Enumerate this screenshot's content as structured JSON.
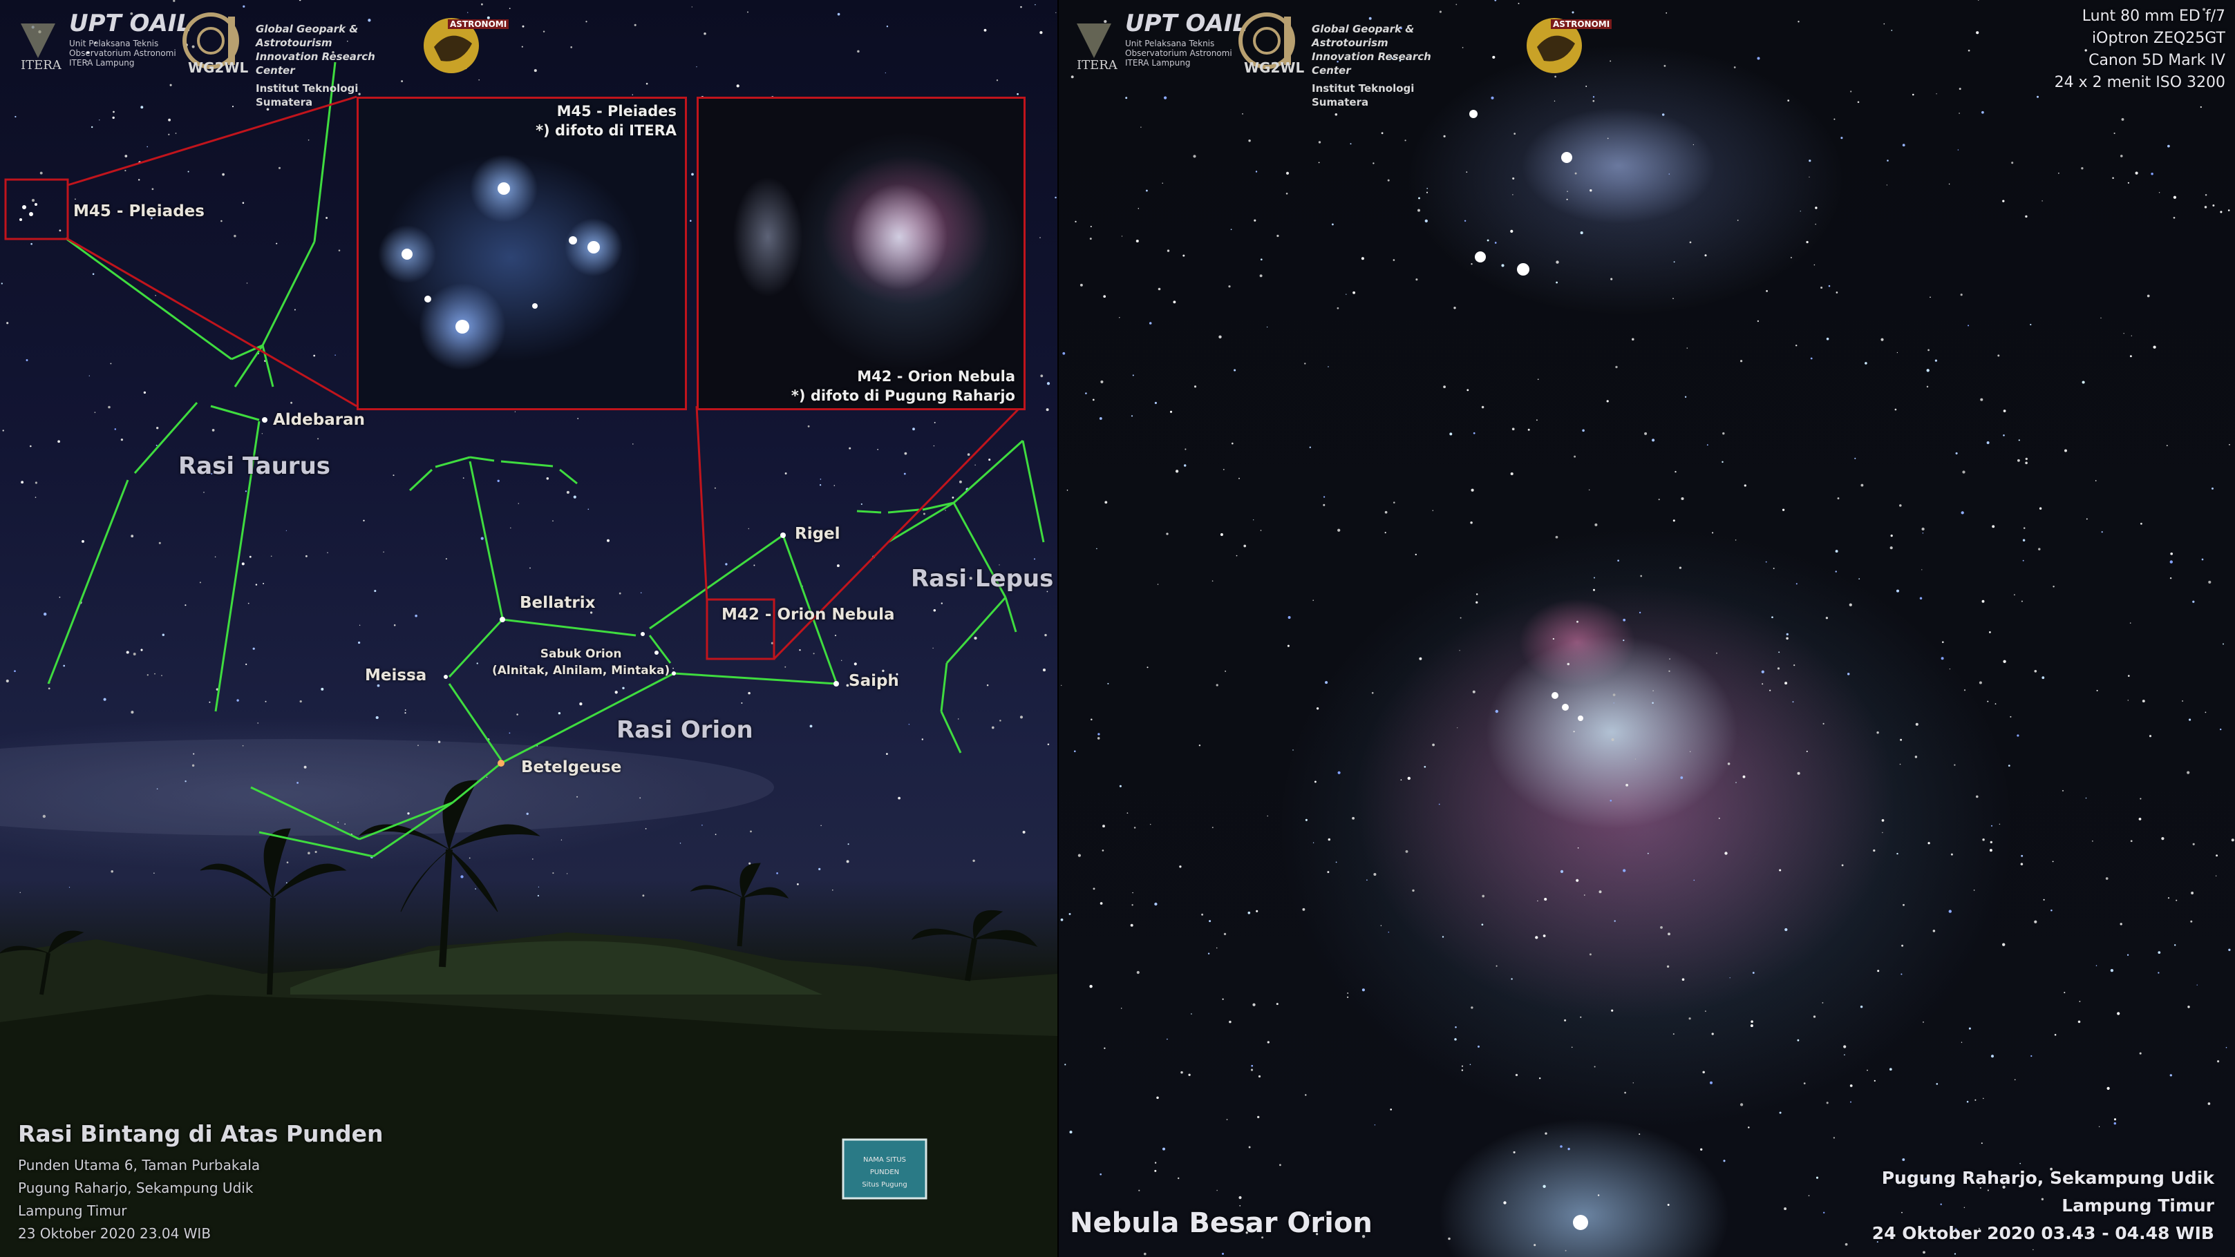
{
  "left_panel": {
    "logos": {
      "upt_title": "UPT OAIL",
      "upt_sub": [
        "Unit Pelaksana Teknis",
        "Observatorium Astronomi",
        "ITERA Lampung"
      ],
      "itera": "ITERA",
      "wg2wl": "WG2WL",
      "puslit_lines": [
        "Global Geopark & Astrotourism",
        "Innovation Research Center",
        "Institut Teknologi Sumatera"
      ],
      "astronomi": "ASTRONOMI"
    },
    "insets": {
      "pleiades_caption": [
        "M45 - Pleiades",
        "*) difoto di ITERA"
      ],
      "orion_caption": [
        "M42 - Orion Nebula",
        "*) difoto di Pugung Raharjo"
      ]
    },
    "star_labels": {
      "m45": "M45 - Pleiades",
      "aldebaran": "Aldebaran",
      "bellatrix": "Bellatrix",
      "meissa": "Meissa",
      "sabuk_orion": "Sabuk Orion",
      "sabuk_orion_sub": "(Alnitak, Alnilam, Mintaka)",
      "betelgeuse": "Betelgeuse",
      "rigel": "Rigel",
      "saiph": "Saiph",
      "m42": "M42 - Orion Nebula"
    },
    "constellations": {
      "taurus": "Rasi Taurus",
      "orion": "Rasi Orion",
      "lepus": "Rasi Lepus"
    },
    "caption": {
      "title": "Rasi Bintang di Atas Punden",
      "lines": [
        "Punden Utama 6, Taman Purbakala",
        "Pugung Raharjo, Sekampung Udik",
        "Lampung Timur",
        "23 Oktober 2020 23.04 WIB"
      ]
    },
    "sign_text": [
      "NAMA SITUS",
      "PUNDEN",
      "Situs Pugung"
    ]
  },
  "right_panel": {
    "equipment": [
      "Lunt 80 mm ED f/7",
      "iOptron ZEQ25GT",
      "Canon 5D Mark IV",
      "24 x 2 menit ISO 3200"
    ],
    "title": "Nebula Besar Orion",
    "location": [
      "Pugung Raharjo, Sekampung Udik",
      "Lampung Timur",
      "24 Oktober 2020 03.43 - 04.48 WIB"
    ]
  },
  "colors": {
    "constellation_line": "#3fdc3f",
    "inset_border": "#c0141c",
    "text": "#e8e4dc"
  }
}
